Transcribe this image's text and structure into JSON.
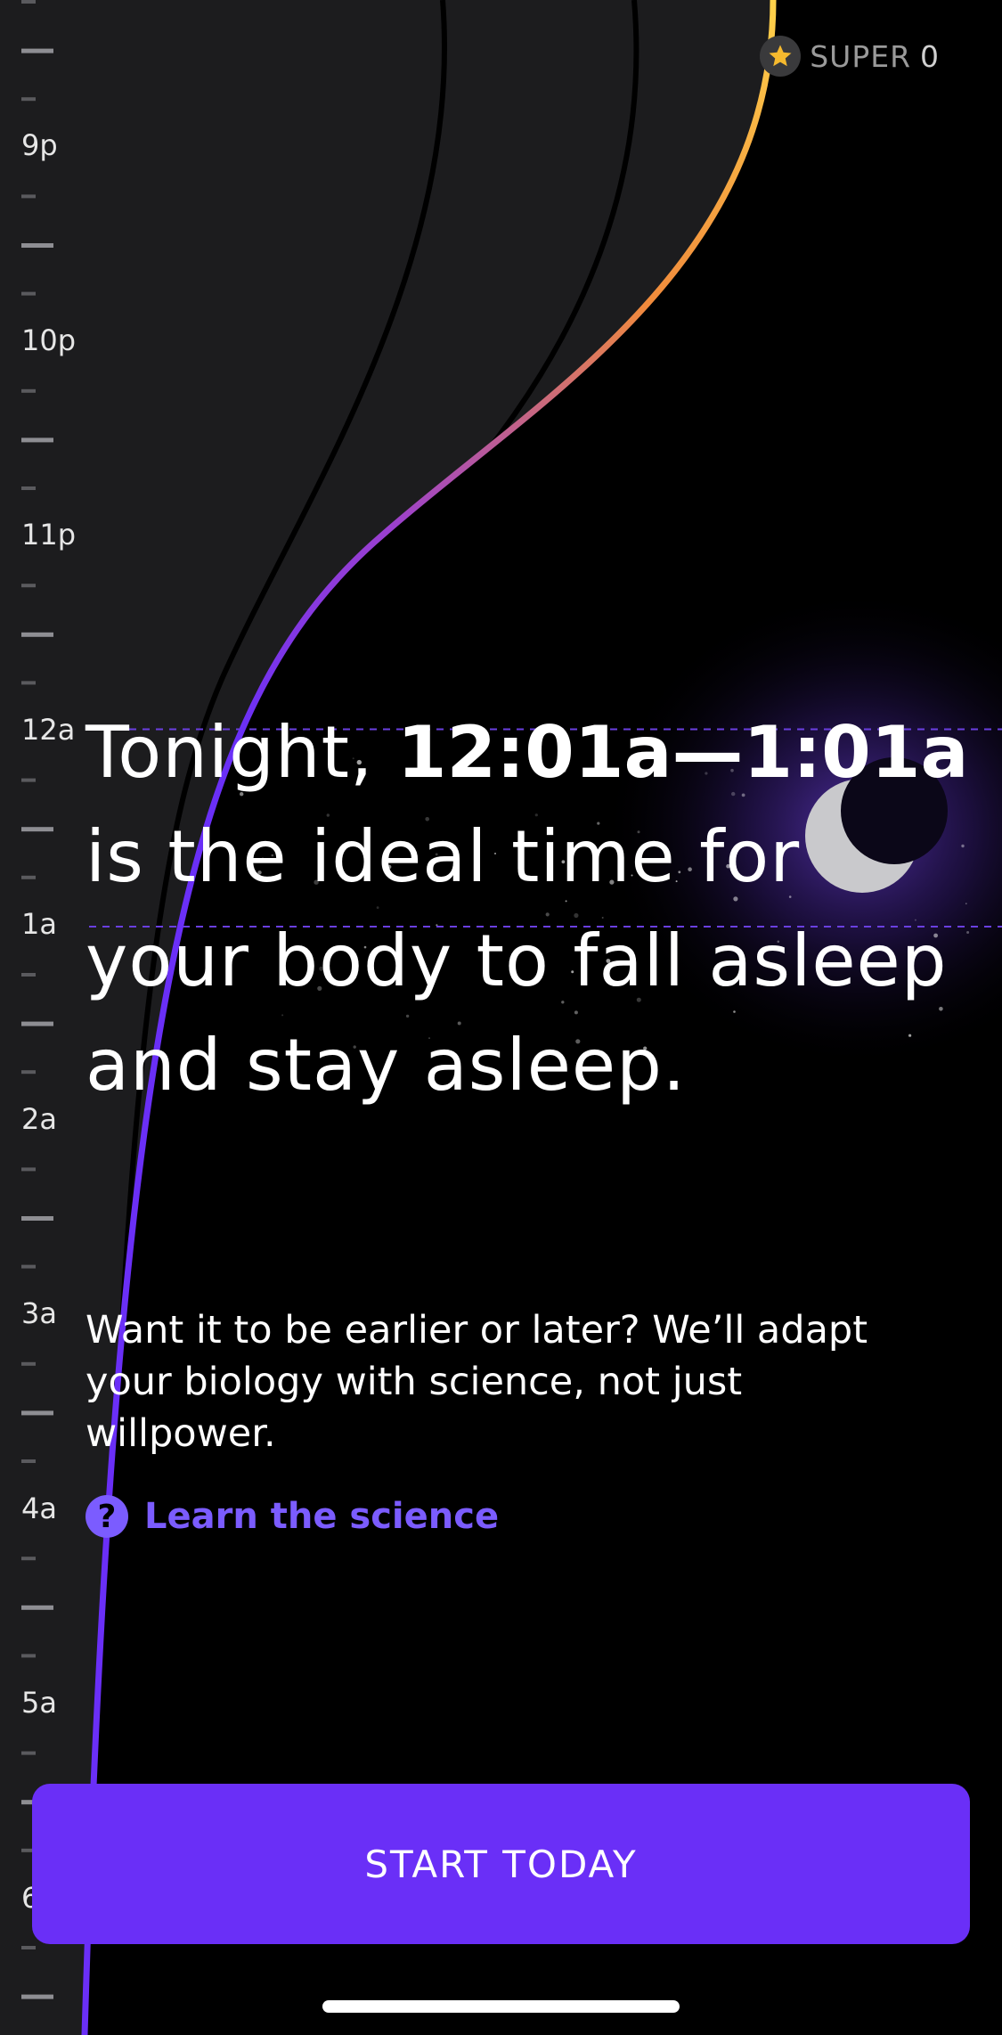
{
  "header": {
    "badge_label": "SUPER",
    "badge_count": "0"
  },
  "timeline": {
    "labels": [
      {
        "text": "9p",
        "hour": 21
      },
      {
        "text": "10p",
        "hour": 22
      },
      {
        "text": "11p",
        "hour": 23
      },
      {
        "text": "12a",
        "hour": 24
      },
      {
        "text": "1a",
        "hour": 25
      },
      {
        "text": "2a",
        "hour": 26
      },
      {
        "text": "3a",
        "hour": 27
      },
      {
        "text": "4a",
        "hour": 28
      },
      {
        "text": "5a",
        "hour": 29
      },
      {
        "text": "6",
        "hour": 30
      }
    ],
    "window_start_hour": 24.0,
    "window_end_hour": 25.0
  },
  "headline": {
    "prefix": "Tonight, ",
    "time_range": "12:01a—1:01a",
    "suffix": " is the ideal time for your body to fall asleep and stay asleep."
  },
  "body": {
    "text": "Want it to be earlier or later? We’ll adapt your biology with science, not just willpower."
  },
  "learn_link": {
    "icon_glyph": "?",
    "label": "Learn the science"
  },
  "cta": {
    "label": "START TODAY"
  },
  "colors": {
    "accent": "#6a2ff7",
    "link": "#7b5cff",
    "curve_start": "#ffd24a",
    "curve_mid": "#f08a3c",
    "curve_end": "#6a2ff7",
    "panel": "#1c1c1e"
  },
  "icons": {
    "badge": "star-icon",
    "moon": "moon-icon",
    "help": "question-icon"
  }
}
